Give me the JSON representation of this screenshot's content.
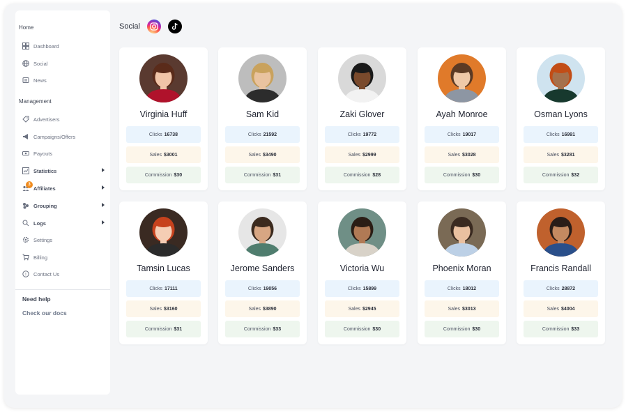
{
  "sidebar": {
    "home_heading": "Home",
    "home_items": [
      {
        "label": "Dashboard",
        "icon": "grid-icon"
      },
      {
        "label": "Social",
        "icon": "globe-icon"
      },
      {
        "label": "News",
        "icon": "news-icon"
      }
    ],
    "management_heading": "Management",
    "management_items": [
      {
        "label": "Advertisers",
        "icon": "tag-icon"
      },
      {
        "label": "Campaigns/Offers",
        "icon": "megaphone-icon"
      },
      {
        "label": "Payouts",
        "icon": "money-icon"
      },
      {
        "label": "Statistics",
        "icon": "chart-icon"
      },
      {
        "label": "Affiliates",
        "icon": "users-icon",
        "badge": "3"
      },
      {
        "label": "Grouping",
        "icon": "group-icon"
      },
      {
        "label": "Logs",
        "icon": "search-log-icon"
      },
      {
        "label": "Settings",
        "icon": "gear-icon"
      },
      {
        "label": "Billing",
        "icon": "cart-icon"
      },
      {
        "label": "Contact Us",
        "icon": "support-icon"
      }
    ],
    "help_title": "Need help",
    "help_link": "Check our docs"
  },
  "header": {
    "title": "Social",
    "icons": [
      "instagram-icon",
      "tiktok-icon"
    ]
  },
  "labels": {
    "clicks": "Clicks",
    "sales": "Sales",
    "commission": "Commission"
  },
  "colors": {
    "clicks_bg": "#eaf4fd",
    "sales_bg": "#fdf6ea",
    "commission_bg": "#eef6ee",
    "badge": "#f08c1f"
  },
  "affiliates": [
    {
      "name": "Virginia Huff",
      "clicks": "16738",
      "sales": "$3001",
      "commission": "$30"
    },
    {
      "name": "Sam Kid",
      "clicks": "21592",
      "sales": "$3490",
      "commission": "$31"
    },
    {
      "name": "Zaki Glover",
      "clicks": "19772",
      "sales": "$2999",
      "commission": "$28"
    },
    {
      "name": "Ayah Monroe",
      "clicks": "19017",
      "sales": "$3028",
      "commission": "$30"
    },
    {
      "name": "Osman Lyons",
      "clicks": "16991",
      "sales": "$3281",
      "commission": "$32"
    },
    {
      "name": "Tamsin Lucas",
      "clicks": "17111",
      "sales": "$3160",
      "commission": "$31"
    },
    {
      "name": "Jerome Sanders",
      "clicks": "19056",
      "sales": "$3890",
      "commission": "$33"
    },
    {
      "name": "Victoria Wu",
      "clicks": "15899",
      "sales": "$2945",
      "commission": "$30"
    },
    {
      "name": "Phoenix Moran",
      "clicks": "18012",
      "sales": "$3013",
      "commission": "$30"
    },
    {
      "name": "Francis Randall",
      "clicks": "28872",
      "sales": "$4004",
      "commission": "$33"
    }
  ]
}
